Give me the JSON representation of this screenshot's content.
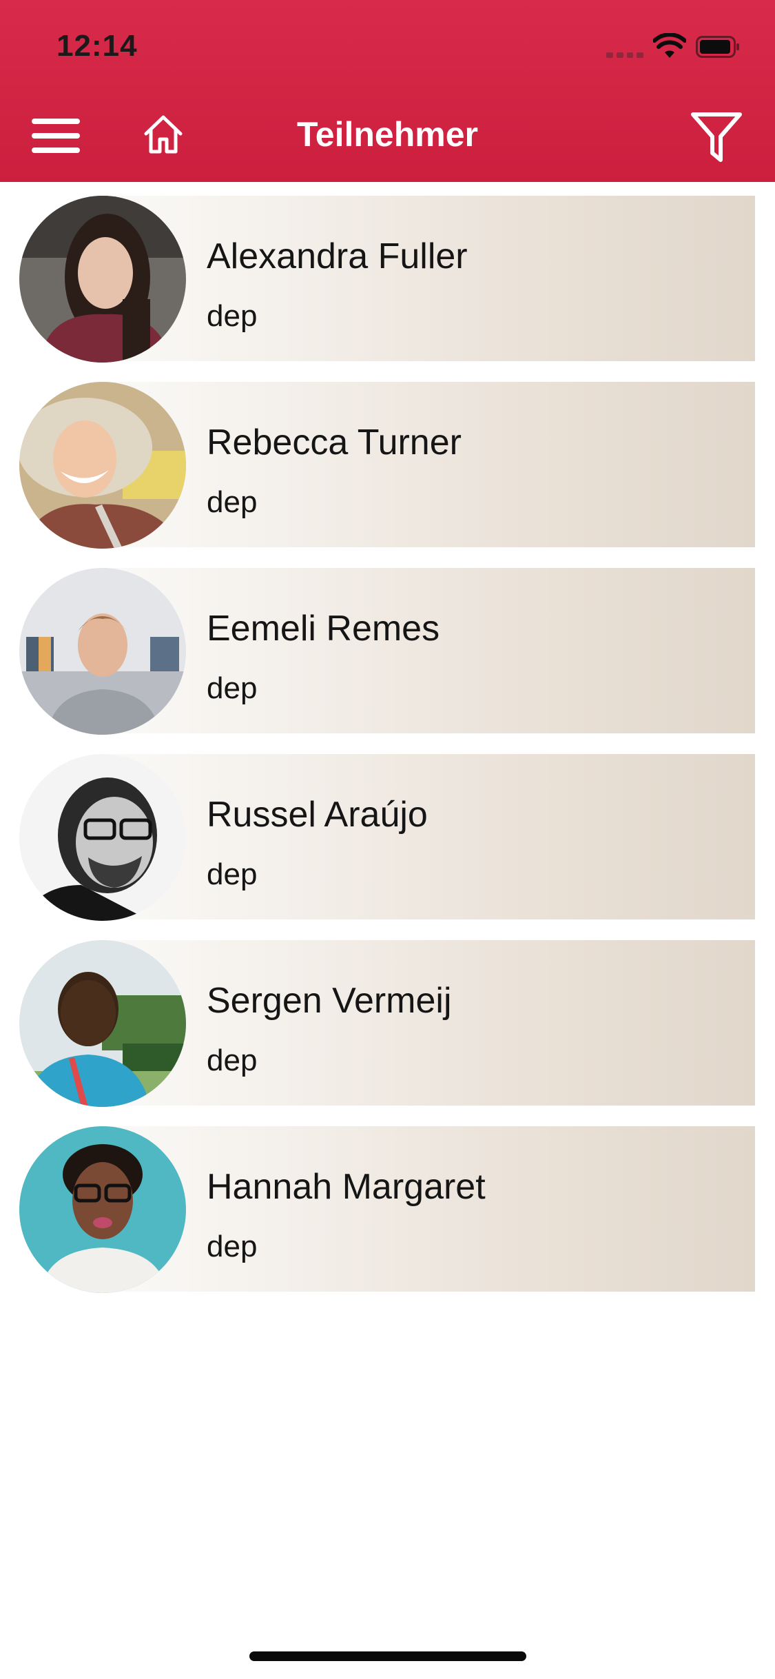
{
  "status_bar": {
    "time": "12:14"
  },
  "nav": {
    "title": "Teilnehmer",
    "menu_icon": "hamburger-menu-icon",
    "home_icon": "home-icon",
    "filter_icon": "filter-funnel-icon",
    "accent_color": "#d5284a"
  },
  "participants": [
    {
      "name": "Alexandra Fuller",
      "department": "dep"
    },
    {
      "name": "Rebecca Turner",
      "department": "dep"
    },
    {
      "name": "Eemeli Remes",
      "department": "dep"
    },
    {
      "name": "Russel Araújo",
      "department": "dep"
    },
    {
      "name": "Sergen Vermeij",
      "department": "dep"
    },
    {
      "name": "Hannah Margaret",
      "department": "dep"
    }
  ]
}
